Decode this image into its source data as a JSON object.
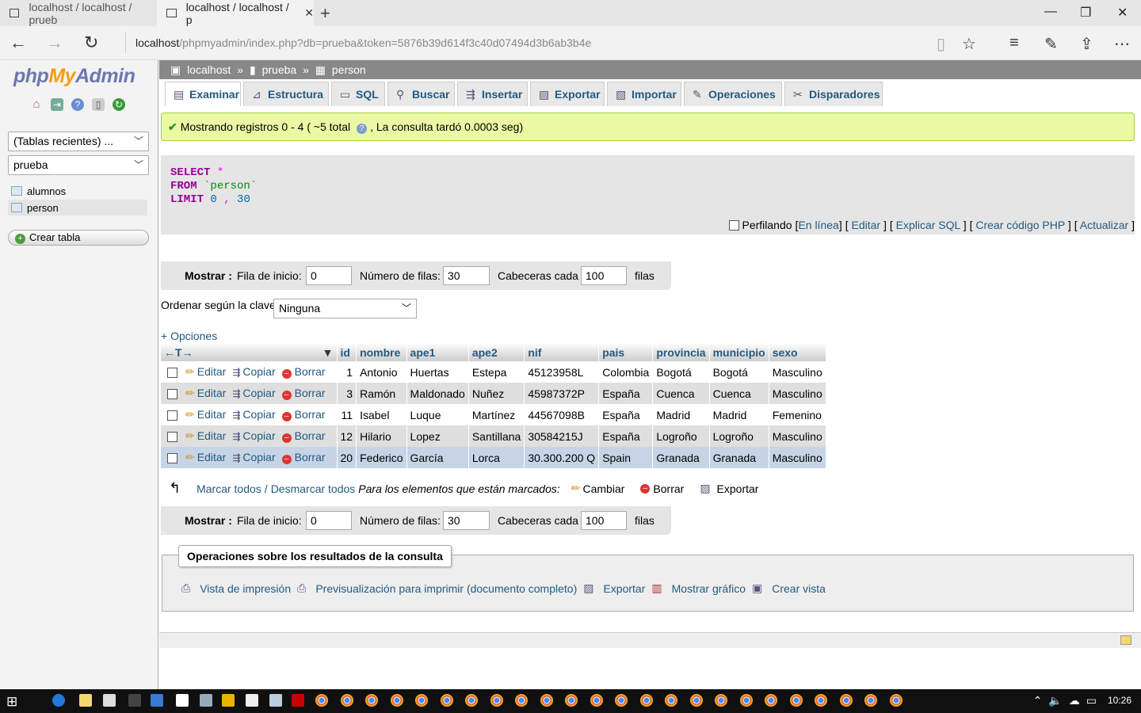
{
  "browser": {
    "tabs": [
      {
        "title": "localhost / localhost / prueb"
      },
      {
        "title": "localhost / localhost / p"
      }
    ],
    "url_host": "localhost",
    "url_path": "/phpmyadmin/index.php?db=prueba&token=5876b39d614f3c40d07494d3b6ab3b4e",
    "new_tab": "+",
    "minimize": "—",
    "restore": "❐",
    "close": "✕"
  },
  "sidebar": {
    "logo_php": "php",
    "logo_my": "My",
    "logo_admin": "Admin",
    "recent_tables": "(Tablas recientes) ...",
    "database": "prueba",
    "tables": [
      "alumnos",
      "person"
    ],
    "create_table": "Crear tabla"
  },
  "breadcrumb": {
    "server": "localhost",
    "database": "prueba",
    "table": "person",
    "sep": "»"
  },
  "tabs": [
    "Examinar",
    "Estructura",
    "SQL",
    "Buscar",
    "Insertar",
    "Exportar",
    "Importar",
    "Operaciones",
    "Disparadores"
  ],
  "success": {
    "text": "Mostrando registros 0 - 4 ( ~5 total",
    "timing": ", La consulta tardó 0.0003 seg)"
  },
  "sql": {
    "select": "SELECT",
    "star": "*",
    "from": "FROM",
    "table": "`person`",
    "limit": "LIMIT",
    "offset": "0",
    "comma": ",",
    "count": "30"
  },
  "sql_actions": {
    "profiling": "Perfilando",
    "inline": "En línea",
    "edit": "Editar",
    "explain": "Explicar SQL",
    "php": "Crear código PHP",
    "refresh": "Actualizar"
  },
  "navigation": {
    "show_label": "Mostrar :",
    "start_row_label": "Fila de inicio:",
    "start_row": "0",
    "num_rows_label": "Número de filas:",
    "num_rows": "30",
    "headers_every_label": "Cabeceras cada",
    "headers_every": "100",
    "rows_suffix": "filas"
  },
  "sort": {
    "label": "Ordenar según la clave:",
    "value": "Ninguna"
  },
  "options_link": "+ Opciones",
  "table": {
    "columns": [
      "id",
      "nombre",
      "ape1",
      "ape2",
      "nif",
      "pais",
      "provincia",
      "municipio",
      "sexo"
    ],
    "actions": {
      "edit": "Editar",
      "copy": "Copiar",
      "delete": "Borrar"
    },
    "rows": [
      [
        "1",
        "Antonio",
        "Huertas",
        "Estepa",
        "45123958L",
        "Colombia",
        "Bogotá",
        "Bogotá",
        "Masculino"
      ],
      [
        "3",
        "Ramón",
        "Maldonado",
        "Nuñez",
        "45987372P",
        "España",
        "Cuenca",
        "Cuenca",
        "Masculino"
      ],
      [
        "11",
        "Isabel",
        "Luque",
        "Martínez",
        "44567098B",
        "España",
        "Madrid",
        "Madrid",
        "Femenino"
      ],
      [
        "12",
        "Hilario",
        "Lopez",
        "Santillana",
        "30584215J",
        "España",
        "Logroño",
        "Logroño",
        "Masculino"
      ],
      [
        "20",
        "Federico",
        "García",
        "Lorca",
        "30.300.200 Q",
        "Spain",
        "Granada",
        "Granada",
        "Masculino"
      ]
    ]
  },
  "bulk": {
    "check_all": "Marcar todos",
    "sep": "/",
    "uncheck_all": "Desmarcar todos",
    "with_selected": "Para los elementos que están marcados:",
    "change": "Cambiar",
    "delete": "Borrar",
    "export": "Exportar"
  },
  "query_ops": {
    "legend": "Operaciones sobre los resultados de la consulta",
    "print_view": "Vista de impresión",
    "print_full": "Previsualización para imprimir (documento completo)",
    "export": "Exportar",
    "chart": "Mostrar gráfico",
    "create_view": "Crear vista"
  },
  "taskbar": {
    "clock": "10:26"
  }
}
